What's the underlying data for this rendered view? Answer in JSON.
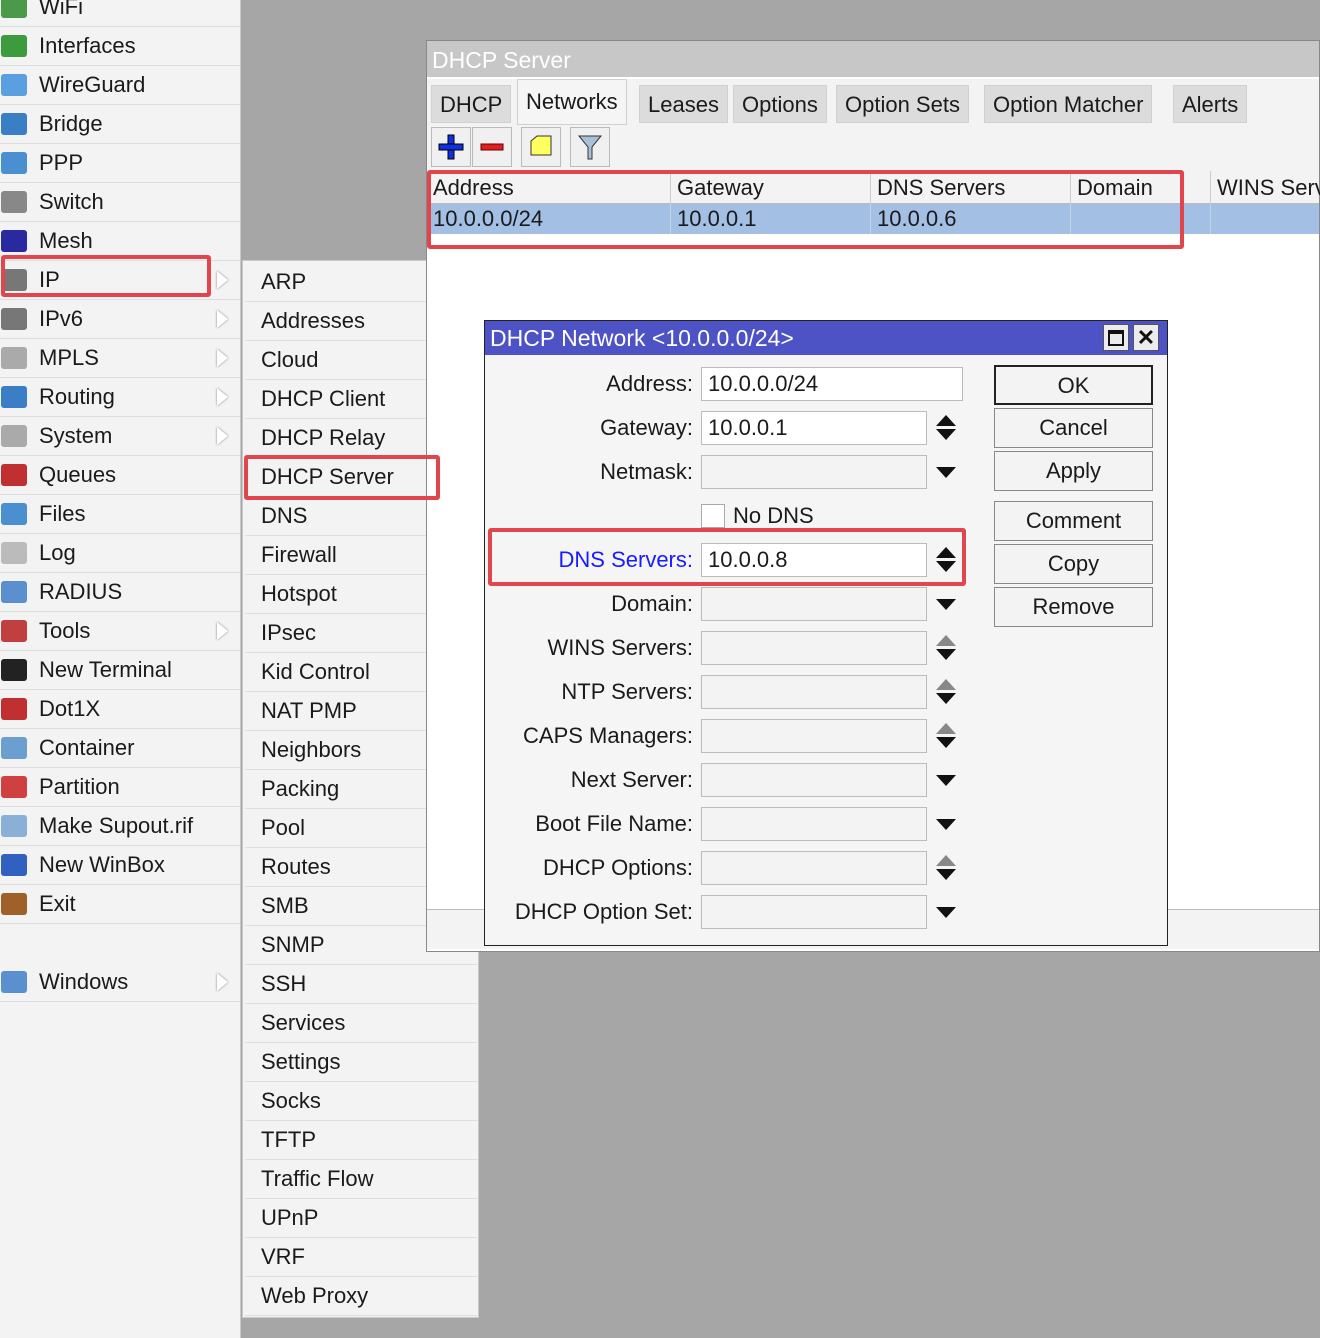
{
  "sidebar": {
    "items": [
      {
        "label": "WiFi",
        "icon": "wifi-icon",
        "color": "#4a9a4a",
        "sub": false
      },
      {
        "label": "Interfaces",
        "icon": "interfaces-icon",
        "color": "#3c9b3c",
        "sub": false
      },
      {
        "label": "WireGuard",
        "icon": "wireguard-icon",
        "color": "#5a9fe0",
        "sub": false
      },
      {
        "label": "Bridge",
        "icon": "bridge-icon",
        "color": "#3a7fc6",
        "sub": false
      },
      {
        "label": "PPP",
        "icon": "ppp-icon",
        "color": "#4a8fd0",
        "sub": false
      },
      {
        "label": "Switch",
        "icon": "switch-icon",
        "color": "#888888",
        "sub": false
      },
      {
        "label": "Mesh",
        "icon": "mesh-icon",
        "color": "#2a2aa0",
        "sub": false
      },
      {
        "label": "IP",
        "icon": "ip-icon",
        "color": "#777777",
        "sub": true
      },
      {
        "label": "IPv6",
        "icon": "ipv6-icon",
        "color": "#777777",
        "sub": true
      },
      {
        "label": "MPLS",
        "icon": "mpls-icon",
        "color": "#aaaaaa",
        "sub": true
      },
      {
        "label": "Routing",
        "icon": "routing-icon",
        "color": "#3a7fc6",
        "sub": true
      },
      {
        "label": "System",
        "icon": "system-icon",
        "color": "#aaaaaa",
        "sub": true
      },
      {
        "label": "Queues",
        "icon": "queues-icon",
        "color": "#c03030",
        "sub": false
      },
      {
        "label": "Files",
        "icon": "files-icon",
        "color": "#4a8fd0",
        "sub": false
      },
      {
        "label": "Log",
        "icon": "log-icon",
        "color": "#bbbbbb",
        "sub": false
      },
      {
        "label": "RADIUS",
        "icon": "radius-icon",
        "color": "#5a8fd0",
        "sub": false
      },
      {
        "label": "Tools",
        "icon": "tools-icon",
        "color": "#c04040",
        "sub": true
      },
      {
        "label": "New Terminal",
        "icon": "terminal-icon",
        "color": "#222222",
        "sub": false
      },
      {
        "label": "Dot1X",
        "icon": "dot1x-icon",
        "color": "#c03030",
        "sub": false
      },
      {
        "label": "Container",
        "icon": "container-icon",
        "color": "#6a9fd0",
        "sub": false
      },
      {
        "label": "Partition",
        "icon": "partition-icon",
        "color": "#d04040",
        "sub": false
      },
      {
        "label": "Make Supout.rif",
        "icon": "supout-icon",
        "color": "#8ab0d8",
        "sub": false
      },
      {
        "label": "New WinBox",
        "icon": "winbox-icon",
        "color": "#3060c0",
        "sub": false
      },
      {
        "label": "Exit",
        "icon": "exit-icon",
        "color": "#a0602a",
        "sub": false
      },
      {
        "label": "",
        "icon": "",
        "color": "",
        "sub": false
      },
      {
        "label": "Windows",
        "icon": "windows-icon",
        "color": "#5a8fd0",
        "sub": true
      }
    ]
  },
  "submenu": {
    "items": [
      "ARP",
      "Addresses",
      "Cloud",
      "DHCP Client",
      "DHCP Relay",
      "DHCP Server",
      "DNS",
      "Firewall",
      "Hotspot",
      "IPsec",
      "Kid Control",
      "NAT PMP",
      "Neighbors",
      "Packing",
      "Pool",
      "Routes",
      "SMB",
      "SNMP",
      "SSH",
      "Services",
      "Settings",
      "Socks",
      "TFTP",
      "Traffic Flow",
      "UPnP",
      "VRF",
      "Web Proxy"
    ]
  },
  "dhcp_window": {
    "title": "DHCP Server",
    "tabs": [
      {
        "label": "DHCP"
      },
      {
        "label": "Networks",
        "active": true
      },
      {
        "label": "Leases"
      },
      {
        "label": "Options"
      },
      {
        "label": "Option Sets"
      },
      {
        "label": "Option Matcher"
      },
      {
        "label": "Alerts"
      }
    ],
    "columns": [
      "Address",
      "Gateway",
      "DNS Servers",
      "Domain",
      "WINS Serv"
    ],
    "rows": [
      [
        "10.0.0.0/24",
        "10.0.0.1",
        "10.0.0.6",
        "",
        ""
      ]
    ]
  },
  "dialog": {
    "title": "DHCP Network <10.0.0.0/24>",
    "fields": [
      {
        "label": "Address:",
        "value": "",
        "type": "none"
      },
      {
        "label": "Gateway:",
        "value": "10.0.0.1",
        "type": "updown"
      },
      {
        "label": "Netmask:",
        "value": "",
        "type": "down"
      },
      {
        "label": "DNS Servers:",
        "value": "10.0.0.8",
        "type": "updown"
      },
      {
        "label": "Domain:",
        "value": "",
        "type": "down"
      },
      {
        "label": "WINS Servers:",
        "value": "",
        "type": "updown-gray"
      },
      {
        "label": "NTP Servers:",
        "value": "",
        "type": "updown-gray"
      },
      {
        "label": "CAPS Managers:",
        "value": "",
        "type": "updown-gray"
      },
      {
        "label": "Next Server:",
        "value": "",
        "type": "down"
      },
      {
        "label": "Boot File Name:",
        "value": "",
        "type": "down"
      },
      {
        "label": "DHCP Options:",
        "value": "",
        "type": "updown-gray"
      },
      {
        "label": "DHCP Option Set:",
        "value": "",
        "type": "down"
      }
    ],
    "address_value": "10.0.0.0/24",
    "no_dns_label": "No DNS",
    "no_dns_checked": false,
    "buttons": [
      "OK",
      "Cancel",
      "Apply",
      "Comment",
      "Copy",
      "Remove"
    ],
    "highlight_label_color": "#1a1aff"
  },
  "colors": {
    "highlight": "#e2464d",
    "dialog_title": "#4d52c4",
    "selected_row": "#a3bfe3"
  }
}
